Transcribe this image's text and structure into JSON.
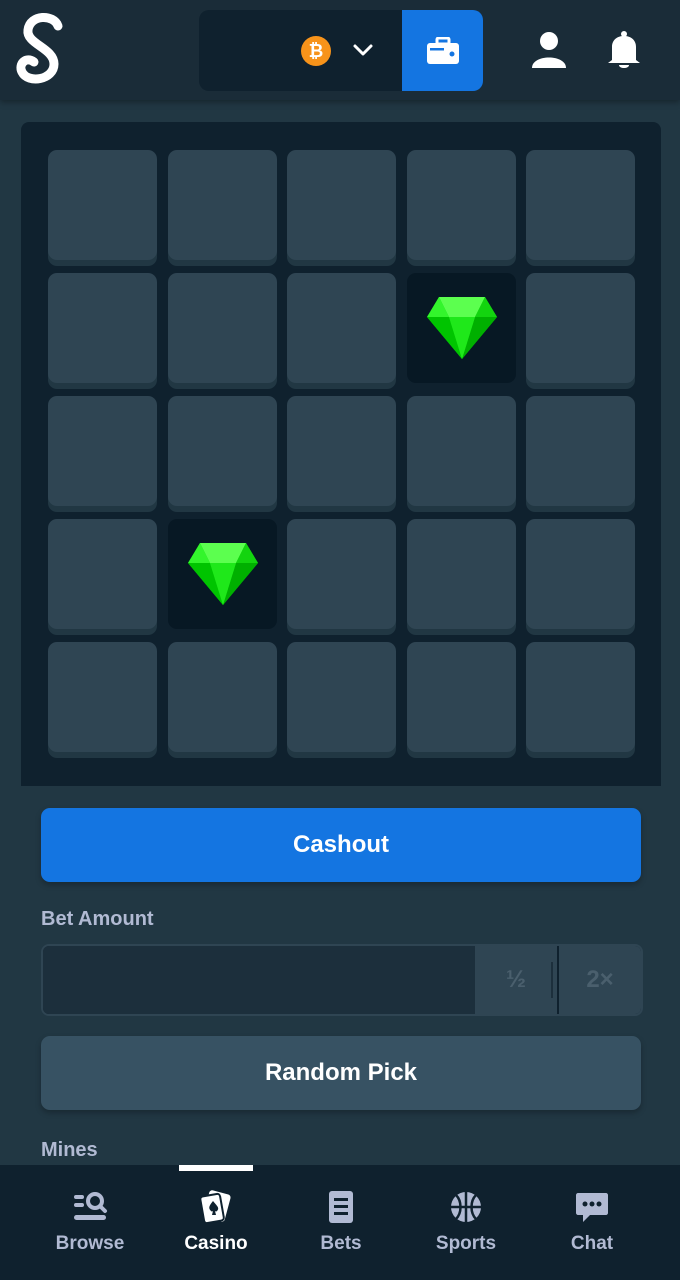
{
  "header": {
    "logo_icon": "stake-logo-icon",
    "currency": {
      "symbol": "₿",
      "icon": "bitcoin-icon",
      "color": "#f7931a"
    },
    "wallet_icon": "wallet-icon",
    "profile_icon": "user-icon",
    "notifications_icon": "bell-icon"
  },
  "game": {
    "grid": {
      "rows": 5,
      "cols": 5
    },
    "revealed_gems": [
      {
        "row": 2,
        "col": 4
      },
      {
        "row": 4,
        "col": 2
      }
    ],
    "gem_color": "#00e701"
  },
  "controls": {
    "cashout_label": "Cashout",
    "bet_amount_label": "Bet Amount",
    "bet_amount_value": "",
    "half_label": "½",
    "double_label": "2×",
    "random_pick_label": "Random Pick",
    "mines_label": "Mines"
  },
  "nav": {
    "items": [
      {
        "label": "Browse",
        "icon": "browse-search-icon",
        "active": false
      },
      {
        "label": "Casino",
        "icon": "casino-cards-icon",
        "active": true
      },
      {
        "label": "Bets",
        "icon": "bets-list-icon",
        "active": false
      },
      {
        "label": "Sports",
        "icon": "basketball-icon",
        "active": false
      },
      {
        "label": "Chat",
        "icon": "chat-bubble-icon",
        "active": false
      }
    ]
  },
  "colors": {
    "accent": "#1475e1",
    "background": "#213743",
    "dark": "#0f212e",
    "tile": "#2f4553"
  }
}
